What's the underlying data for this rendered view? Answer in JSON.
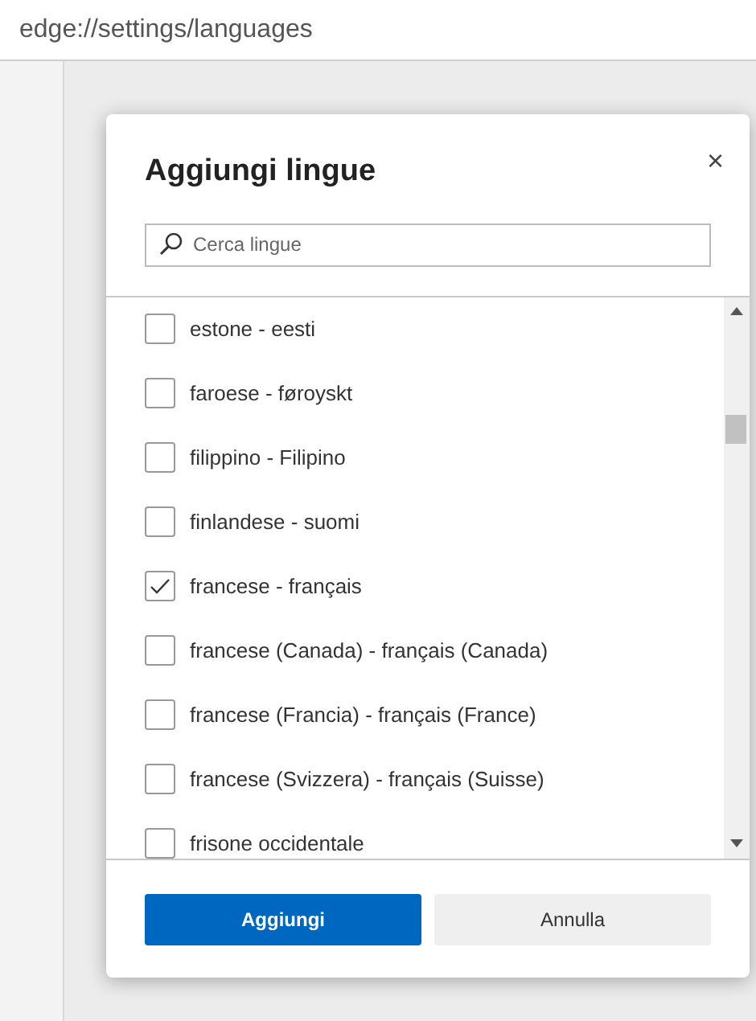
{
  "address_bar": {
    "url": "edge://settings/languages"
  },
  "dialog": {
    "title": "Aggiungi lingue",
    "close": "×",
    "search": {
      "placeholder": "Cerca lingue"
    },
    "languages": [
      {
        "label": "estone - eesti",
        "checked": false
      },
      {
        "label": "faroese - føroyskt",
        "checked": false
      },
      {
        "label": "filippino - Filipino",
        "checked": false
      },
      {
        "label": "finlandese - suomi",
        "checked": false
      },
      {
        "label": "francese - français",
        "checked": true
      },
      {
        "label": "francese (Canada) - français (Canada)",
        "checked": false
      },
      {
        "label": "francese (Francia) - français (France)",
        "checked": false
      },
      {
        "label": "francese (Svizzera) - français (Suisse)",
        "checked": false
      },
      {
        "label": "frisone occidentale",
        "checked": false
      }
    ],
    "buttons": [
      {
        "label": "Aggiungi",
        "kind": "primary"
      },
      {
        "label": "Annulla",
        "kind": "secondary"
      }
    ]
  }
}
